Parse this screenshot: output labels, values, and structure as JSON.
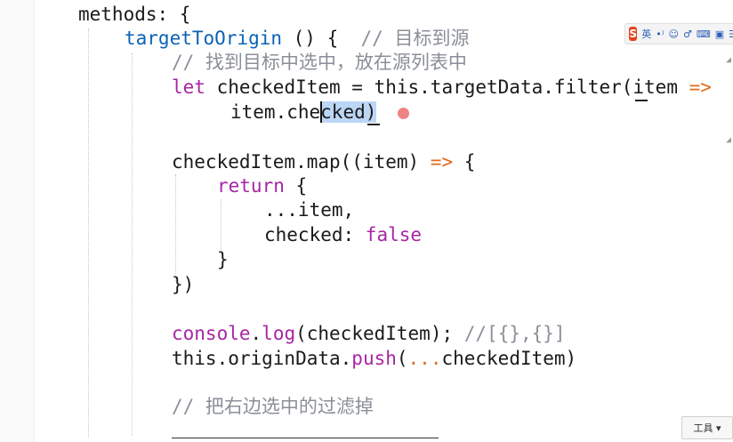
{
  "code": {
    "methods_line": {
      "name": "methods",
      "punct": ": {"
    },
    "target_to_origin": {
      "fn": "targetToOrigin",
      "sig": " () {  ",
      "comment": "// 目标到源"
    },
    "comment_find": "// 找到目标中选中，放在源列表中",
    "let_line": {
      "kw": "let",
      "rest1": " checkedItem = this.targetData.filter",
      "paren": "(",
      "rest2": "item ",
      "arrow": "=>"
    },
    "checked_line": {
      "pre": "item.che",
      "selected": "cked)"
    },
    "map_line": {
      "text": "checkedItem.map((item) ",
      "arrow": "=>",
      "brace": " {"
    },
    "return_line": {
      "kw": "return",
      "brace": " {"
    },
    "spread_line": "...item,",
    "checked_false": {
      "key": "checked: ",
      "value": "false"
    },
    "close_brace": "}",
    "close_map": "})",
    "console_line": {
      "obj": "console",
      "dot": ".",
      "fn": "log",
      "args": "(checkedItem); ",
      "comment": "//[{},{}]"
    },
    "push_line": {
      "pre": "this.originData.",
      "fn": "push",
      "paren_open": "(",
      "spread": "...",
      "args": "checkedItem)"
    },
    "comment_filter": "// 把右边选中的过滤掉"
  },
  "ime_toolbar": {
    "logo": "S",
    "lang": "英",
    "icons": [
      "•⁾",
      "☺",
      "♂",
      "⌨",
      "▣",
      "☰"
    ]
  },
  "toolbox": {
    "label": "工具 ▾"
  },
  "colors": {
    "keyword": "#a626a4",
    "function": "#0b62b5",
    "comment": "#8a8f98",
    "operator": "#e06c1a",
    "selection": "#bcd6f5",
    "breakpoint": "#f08484"
  }
}
